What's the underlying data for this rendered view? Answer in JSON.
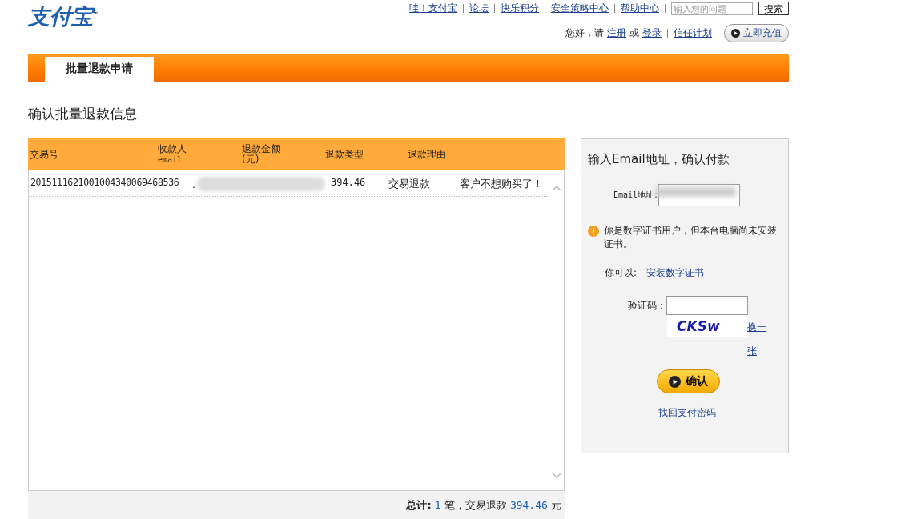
{
  "logo": {
    "text": "支付宝",
    "mark": "™"
  },
  "top_links": [
    "哇！支付宝",
    "论坛",
    "快乐积分",
    "安全策略中心",
    "帮助中心"
  ],
  "search": {
    "placeholder": "输入您的问题",
    "button": "搜索"
  },
  "greeting": {
    "prefix": "您好，请",
    "register": "注册",
    "or": "或",
    "login": "登录",
    "trust": "信任计划",
    "recharge": "立即充值"
  },
  "tabs": [
    {
      "label": "批量退款申请",
      "selected": true
    }
  ],
  "page_title": "确认批量退款信息",
  "table": {
    "columns": [
      {
        "label": "交易号"
      },
      {
        "label": "收款人",
        "sub": "email"
      },
      {
        "label": "退款金额",
        "sub": "(元)"
      },
      {
        "label": "退款类型"
      },
      {
        "label": "退款理由"
      }
    ],
    "rows": [
      {
        "trade_no": "2015111621001004340069468536",
        "email_prefix": ".",
        "amount": "394.46",
        "type": "交易退款",
        "reason": "客户不想购买了！"
      }
    ],
    "total": {
      "label": "总计:",
      "count": "1",
      "unit": "笔，交易退款",
      "amount": "394.46",
      "currency": "元"
    }
  },
  "panel": {
    "title": "输入Email地址，确认付款",
    "email_label": "Email地址:",
    "warning": "你是数字证书用户，但本台电脑尚未安装证书。",
    "can_label": "你可以:",
    "install_link": "安装数字证书",
    "captcha_label": "验证码：",
    "captcha_text": "CKSw",
    "refresh_link": "换一张",
    "confirm": "确认",
    "recover_link": "找回支付密码"
  }
}
